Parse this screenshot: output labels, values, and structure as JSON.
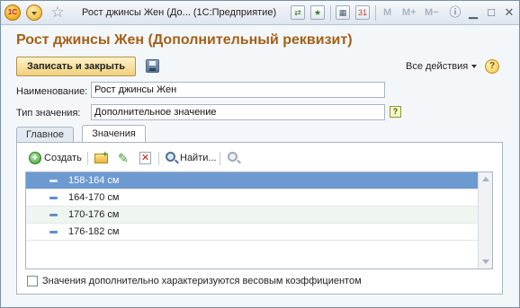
{
  "titlebar": {
    "title": "Рост джинсы Жен (До... (1С:Предприятие)",
    "logo_text": "1С",
    "memory_buttons": [
      "M",
      "M+",
      "M−"
    ],
    "calendar_day": "31"
  },
  "form": {
    "title": "Рост джинсы Жен (Дополнительный реквизит)",
    "save_close_label": "Записать и закрыть",
    "all_actions_label": "Все действия",
    "help_glyph": "?"
  },
  "fields": {
    "name_label": "Наименование:",
    "name_value": "Рост джинсы Жен",
    "type_label": "Тип значения:",
    "type_value": "Дополнительное значение",
    "type_hint": "?"
  },
  "tabs": [
    {
      "label": "Главное",
      "active": false
    },
    {
      "label": "Значения",
      "active": true
    }
  ],
  "values_toolbar": {
    "create_label": "Создать",
    "find_label": "Найти..."
  },
  "values_list": [
    {
      "text": "158-164 см",
      "selected": true
    },
    {
      "text": "164-170 см",
      "selected": false
    },
    {
      "text": "170-176 см",
      "selected": false
    },
    {
      "text": "176-182 см",
      "selected": false
    }
  ],
  "weight_checkbox": {
    "label": "Значения дополнительно характеризуются весовым коэффициентом",
    "checked": false
  }
}
